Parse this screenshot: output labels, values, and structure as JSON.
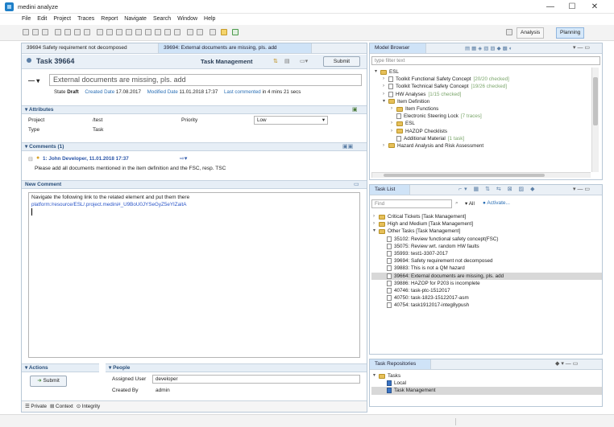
{
  "window": {
    "title": "medini analyze",
    "min": "—",
    "max": "☐",
    "close": "✕"
  },
  "menu": [
    "File",
    "Edit",
    "Project",
    "Traces",
    "Report",
    "Navigate",
    "Search",
    "Window",
    "Help"
  ],
  "perspectives": {
    "analysis": "Analysis",
    "planning": "Planning"
  },
  "editor_tabs": [
    "39694 Safety requirement not decomposed",
    "39694: External documents are missing, pls. add"
  ],
  "task": {
    "id_label": "Task 39664",
    "header_title": "Task Management",
    "submit": "Submit",
    "summary": "External documents are missing, pls. add",
    "state_label": "State",
    "state_value": "Draft",
    "created_label": "Created Date",
    "created_value": "17.08.2017",
    "modified_label": "Modified Date",
    "modified_value": "11.01.2018 17:37",
    "last_commented_label": "Last commented",
    "last_commented_value": "in 4 mins 21 secs"
  },
  "attributes": {
    "header": "Attributes",
    "project_label": "Project",
    "project_value": "/test",
    "type_label": "Type",
    "type_value": "Task",
    "priority_label": "Priority",
    "priority_value": "Low"
  },
  "comments": {
    "header": "Comments (1)",
    "author_line": "1: John Developer, 11.01.2018 17:37",
    "text": "Please add all documents mentioned in the item definition and the FSC, resp. TSC"
  },
  "new_comment": {
    "header": "New Comment",
    "line1": "Navigate the following link to the related element and put them there",
    "link": "platform:/resource/ESL/.project.medini#_U9BoU0JYSeGyZ5eYIZaitA"
  },
  "actions": {
    "header": "Actions",
    "submit": "Submit"
  },
  "people": {
    "header": "People",
    "assigned_label": "Assigned User",
    "assigned_value": "developer",
    "created_label": "Created By",
    "created_value": "admin"
  },
  "bottom_tabs": [
    "Private",
    "Context",
    "Integrity"
  ],
  "model_browser": {
    "tab": "Model Browser",
    "filter_placeholder": "type filter text",
    "items": [
      {
        "text": "ESL",
        "level": 0,
        "icon": "folder",
        "arrow": "▾",
        "extra": ""
      },
      {
        "text": "Toolkit Functional Safety Concept",
        "level": 1,
        "icon": "doc",
        "arrow": "›",
        "extra": "[20/20 checked]"
      },
      {
        "text": "Toolkit Technical Safety Concept",
        "level": 1,
        "icon": "doc",
        "arrow": "›",
        "extra": "[19/26 checked]"
      },
      {
        "text": "HW Analyses",
        "level": 1,
        "icon": "doc",
        "arrow": "›",
        "extra": "[1/15 checked]"
      },
      {
        "text": "Item Definition",
        "level": 1,
        "icon": "folder",
        "arrow": "▾",
        "extra": ""
      },
      {
        "text": "Item Functions",
        "level": 2,
        "icon": "folder",
        "arrow": "›",
        "extra": ""
      },
      {
        "text": "Electronic Steering Lock",
        "level": 2,
        "icon": "doc",
        "arrow": "",
        "extra": "[7 traces]"
      },
      {
        "text": "ESL",
        "level": 2,
        "icon": "folder",
        "arrow": "›",
        "extra": ""
      },
      {
        "text": "HAZOP Checklists",
        "level": 2,
        "icon": "folder",
        "arrow": "›",
        "extra": ""
      },
      {
        "text": "Additional Material",
        "level": 2,
        "icon": "doc",
        "arrow": "",
        "extra": "[1 task]"
      },
      {
        "text": "Hazard Analysis and Risk Assessment",
        "level": 1,
        "icon": "folder",
        "arrow": "›",
        "extra": ""
      }
    ]
  },
  "task_list": {
    "tab": "Task List",
    "find_placeholder": "Find",
    "all": "All",
    "activate": "Activate...",
    "items": [
      {
        "text": "Critical Tickets  [Task Management]",
        "level": 0,
        "icon": "folder",
        "arrow": "›",
        "selected": false
      },
      {
        "text": "High and Medium  [Task Management]",
        "level": 0,
        "icon": "folder",
        "arrow": "›",
        "selected": false
      },
      {
        "text": "Other Tasks  [Task Management]",
        "level": 0,
        "icon": "folder",
        "arrow": "▾",
        "selected": false
      },
      {
        "text": "35102: Review functional safety concept(FSC)",
        "level": 1,
        "icon": "doc",
        "arrow": "",
        "selected": false
      },
      {
        "text": "35075: Review wrt. random HW faults",
        "level": 1,
        "icon": "doc",
        "arrow": "",
        "selected": false
      },
      {
        "text": "35993: test1-3307-2017",
        "level": 1,
        "icon": "doc",
        "arrow": "",
        "selected": false
      },
      {
        "text": "39694: Safety requirement not decomposed",
        "level": 1,
        "icon": "doc",
        "arrow": "",
        "selected": false
      },
      {
        "text": "39883: This is not a QM hazard",
        "level": 1,
        "icon": "doc",
        "arrow": "",
        "selected": false
      },
      {
        "text": "39664: External documents are missing, pls. add",
        "level": 1,
        "icon": "doc",
        "arrow": "",
        "selected": true
      },
      {
        "text": "39886: HAZOP for P203 is incomplete",
        "level": 1,
        "icon": "doc",
        "arrow": "",
        "selected": false
      },
      {
        "text": "40746: task-ptc-1512017",
        "level": 1,
        "icon": "doc",
        "arrow": "",
        "selected": false
      },
      {
        "text": "40750: task-1823-15122017-asm",
        "level": 1,
        "icon": "doc",
        "arrow": "",
        "selected": false
      },
      {
        "text": "40754: task1912017-integ8ypush",
        "level": 1,
        "icon": "doc",
        "arrow": "",
        "selected": false
      }
    ]
  },
  "repositories": {
    "tab": "Task Repositories",
    "items": [
      {
        "text": "Tasks",
        "level": 0,
        "icon": "folder",
        "arrow": "▾",
        "selected": false
      },
      {
        "text": "Local",
        "level": 1,
        "icon": "repo",
        "arrow": "",
        "selected": false
      },
      {
        "text": "Task Management",
        "level": 1,
        "icon": "repo",
        "arrow": "",
        "selected": true
      }
    ]
  },
  "colors": {
    "accent": "#2a6fb5",
    "link": "#2a55c8",
    "header_bg": "#e6eef6"
  }
}
